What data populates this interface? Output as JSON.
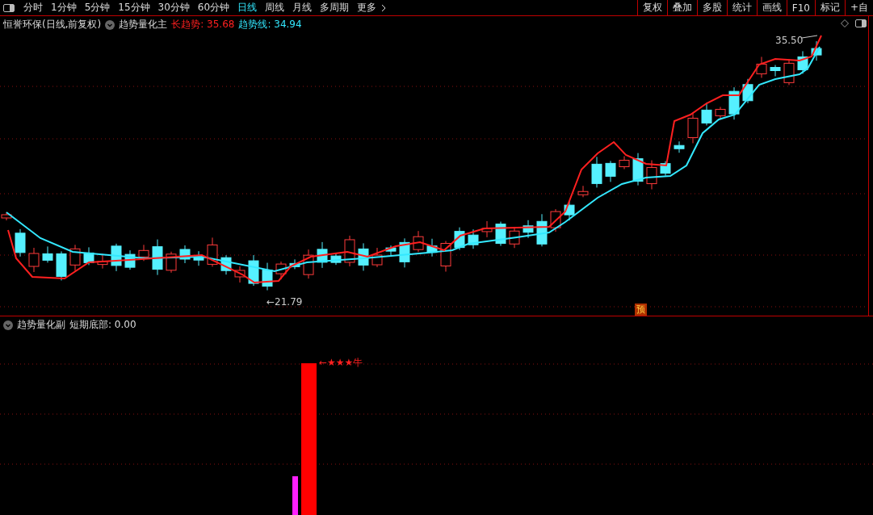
{
  "toolbar": {
    "periods": [
      {
        "label": "分时",
        "selected": false
      },
      {
        "label": "1分钟",
        "selected": false
      },
      {
        "label": "5分钟",
        "selected": false
      },
      {
        "label": "15分钟",
        "selected": false
      },
      {
        "label": "30分钟",
        "selected": false
      },
      {
        "label": "60分钟",
        "selected": false
      },
      {
        "label": "日线",
        "selected": true
      },
      {
        "label": "周线",
        "selected": false
      },
      {
        "label": "月线",
        "selected": false
      },
      {
        "label": "多周期",
        "selected": false
      },
      {
        "label": "更多",
        "selected": false
      }
    ],
    "tools": [
      "复权",
      "叠加",
      "多股",
      "统计",
      "画线",
      "F10",
      "标记",
      "+自"
    ]
  },
  "main_panel": {
    "stock": "恒誉环保(日线,前复权)",
    "indicator": "趋势量化主",
    "series": [
      {
        "text": "长趋势: 35.68",
        "color": "#ff2020"
      },
      {
        "text": "趋势线: 34.94",
        "color": "#33e8ff"
      }
    ],
    "low_label": "←21.79",
    "high_label": "35.50",
    "badge": "预"
  },
  "sub_panel": {
    "indicator": "趋势量化副",
    "readout": "短期底部: 0.00",
    "signal": "←★★★牛"
  }
}
